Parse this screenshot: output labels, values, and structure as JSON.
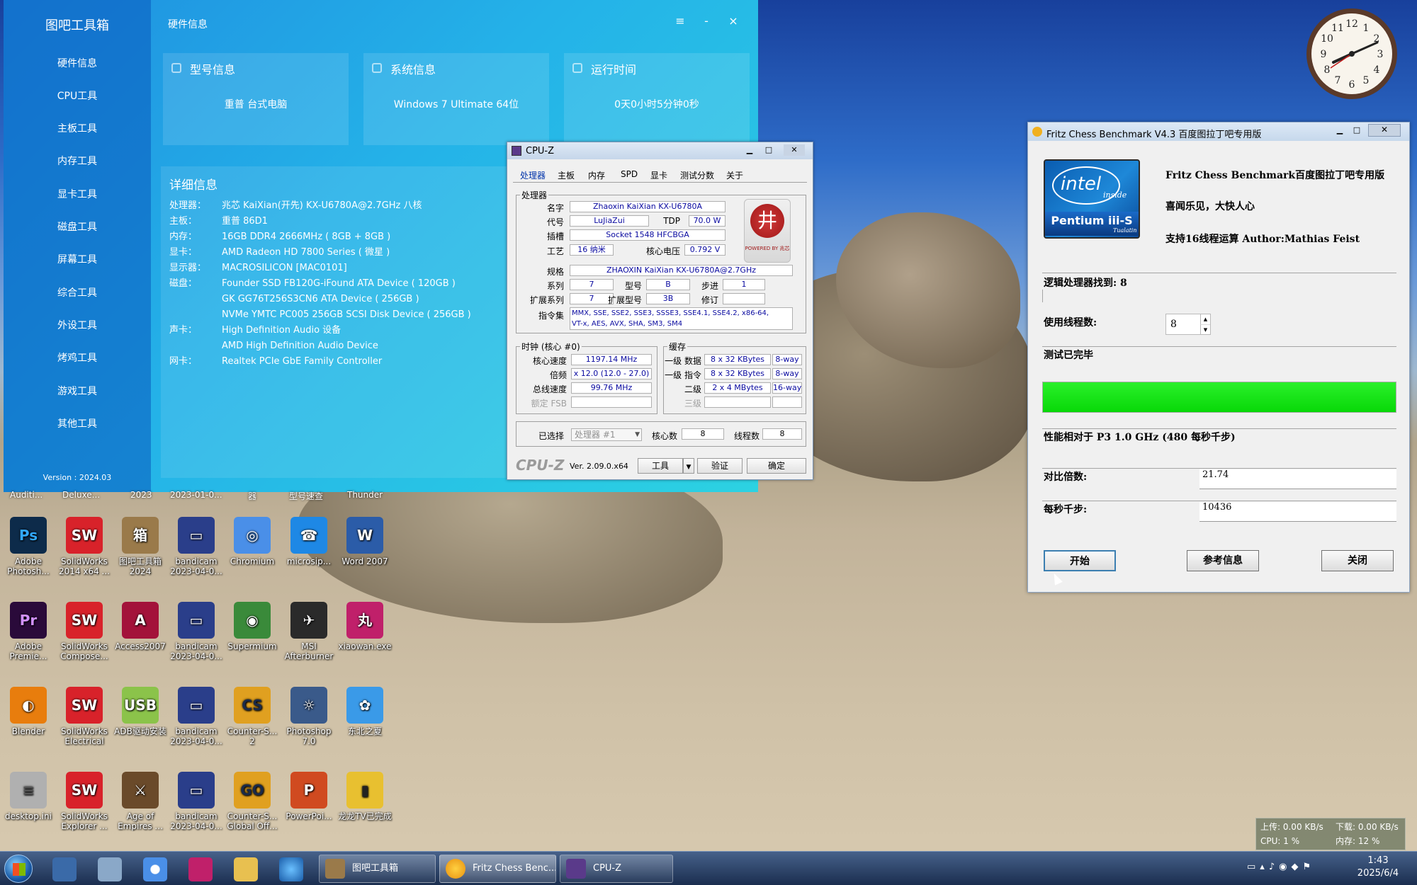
{
  "toolbox": {
    "app_title": "图吧工具箱",
    "window_title": "硬件信息",
    "version": "Version : 2024.03",
    "controls": {
      "menu": "≡",
      "minimize": "-",
      "close": "×"
    },
    "sidebar": [
      "硬件信息",
      "CPU工具",
      "主板工具",
      "内存工具",
      "显卡工具",
      "磁盘工具",
      "屏幕工具",
      "综合工具",
      "外设工具",
      "烤鸡工具",
      "游戏工具",
      "其他工具"
    ],
    "cards": [
      {
        "title": "型号信息",
        "value": "重普 台式电脑"
      },
      {
        "title": "系统信息",
        "value": "Windows 7 Ultimate 64位"
      },
      {
        "title": "运行时间",
        "value": "0天0小时5分钟0秒"
      }
    ],
    "details_title": "详细信息",
    "details": [
      {
        "label": "处理器：",
        "value": "兆芯 KaiXian(开先) KX-U6780A@2.7GHz 八核"
      },
      {
        "label": "主板：",
        "value": "重普 86D1"
      },
      {
        "label": "内存：",
        "value": "16GB DDR4 2666MHz ( 8GB + 8GB )"
      },
      {
        "label": "显卡：",
        "value": "AMD Radeon HD 7800 Series ( 微星 )"
      },
      {
        "label": "显示器：",
        "value": "MACROSILICON [MAC0101]"
      },
      {
        "label": "磁盘：",
        "value": "Founder SSD FB120G-iFound ATA Device ( 120GB )"
      },
      {
        "label": "",
        "value": "GK GG76T256S3CN6 ATA Device ( 256GB )"
      },
      {
        "label": "",
        "value": "NVMe YMTC PC005 256GB SCSI Disk Device ( 256GB )"
      },
      {
        "label": "声卡：",
        "value": "High Definition Audio 设备"
      },
      {
        "label": "",
        "value": "AMD High Definition Audio Device"
      },
      {
        "label": "网卡：",
        "value": "Realtek PCIe GbE Family Controller"
      }
    ]
  },
  "cpuz": {
    "title": "CPU-Z",
    "tabs": [
      "处理器",
      "主板",
      "内存",
      "SPD",
      "显卡",
      "测试分数",
      "关于"
    ],
    "group_processor": "处理器",
    "labels": {
      "name": "名字",
      "codename": "代号",
      "tdp": "TDP",
      "socket": "插槽",
      "process": "工艺",
      "vcore": "核心电压",
      "spec": "规格",
      "family": "系列",
      "model": "型号",
      "stepping": "步进",
      "ext_family": "扩展系列",
      "ext_model": "扩展型号",
      "revision": "修订",
      "instructions": "指令集"
    },
    "values": {
      "name": "Zhaoxin KaiXian KX-U6780A",
      "codename": "LuJiaZui",
      "tdp": "70.0 W",
      "socket": "Socket 1548 HFCBGA",
      "process": "16 纳米",
      "vcore": "0.792 V",
      "spec": "ZHAOXIN KaiXian KX-U6780A@2.7GHz",
      "family": "7",
      "model": "B",
      "stepping": "1",
      "ext_family": "7",
      "ext_model": "3B",
      "revision": "",
      "instructions_line1": "MMX, SSE, SSE2, SSE3, SSSE3, SSE4.1, SSE4.2, x86-64,",
      "instructions_line2": "VT-x, AES, AVX, SHA, SM3, SM4"
    },
    "logo_text": "POWERED BY 兆芯",
    "clock": {
      "group": "时钟 (核心 #0)",
      "core_speed_label": "核心速度",
      "core_speed": "1197.14 MHz",
      "multiplier_label": "倍频",
      "multiplier": "x 12.0 (12.0 - 27.0)",
      "bus_label": "总线速度",
      "bus": "99.76 MHz",
      "fsb_label": "额定 FSB",
      "fsb": ""
    },
    "cache": {
      "group": "缓存",
      "rows": [
        {
          "label": "一级 数据",
          "size": "8 x 32 KBytes",
          "way": "8-way"
        },
        {
          "label": "一级 指令",
          "size": "8 x 32 KBytes",
          "way": "8-way"
        },
        {
          "label": "二级",
          "size": "2 x 4 MBytes",
          "way": "16-way"
        },
        {
          "label": "三级",
          "size": "",
          "way": ""
        }
      ]
    },
    "selection": {
      "label": "已选择",
      "value": "处理器 #1",
      "cores_label": "核心数",
      "cores": "8",
      "threads_label": "线程数",
      "threads": "8"
    },
    "footer": {
      "brand": "CPU-Z",
      "version": "Ver. 2.09.0.x64",
      "tools": "工具",
      "validate": "验证",
      "ok": "确定"
    }
  },
  "fritz": {
    "title": "Fritz Chess Benchmark V4.3  百度图拉丁吧专用版",
    "intel_badge": {
      "brand": "intel",
      "inside": "inside",
      "product": "Pentium iii-S",
      "sub": "Tualatin"
    },
    "header_line1": "Fritz Chess Benchmark百度图拉丁吧专用版",
    "header_line2": "喜闻乐见，大快人心",
    "header_line3": "支持16线程运算  Author:Mathias Feist",
    "logical_processors": "逻辑处理器找到: 8",
    "threads_label": "使用线程数:",
    "threads_value": "8",
    "status": "测试已完毕",
    "progress": 1.0,
    "perf_label": "性能相对于 P3 1.0 GHz (480 每秒千步)",
    "ratio_label": "对比倍数:",
    "ratio_value": "21.74",
    "knps_label": "每秒千步:",
    "knps_value": "10436",
    "buttons": {
      "start": "开始",
      "reference": "参考信息",
      "close": "关闭"
    }
  },
  "desktop": {
    "partial_labels": [
      "Auditi...",
      "Deluxe...",
      "2023",
      "2023-01-0...",
      "器",
      "型号速查",
      "Thunder"
    ],
    "icons": [
      {
        "label": "Adobe Photosh...",
        "glyph": "Ps",
        "color": "#0d2b4a",
        "fg": "#31a8ff"
      },
      {
        "label": "SolidWorks 2014 x64 ...",
        "glyph": "SW",
        "color": "#d8222a",
        "fg": "#ffffff"
      },
      {
        "label": "图吧工具箱 2024",
        "glyph": "箱",
        "color": "#9a7a4a",
        "fg": "#ffffff"
      },
      {
        "label": "bandicam 2023-04-0...",
        "glyph": "▭",
        "color": "#2a3e8a",
        "fg": "#ffffff"
      },
      {
        "label": "Chromium",
        "glyph": "◎",
        "color": "#4a8fe8",
        "fg": "#ffffff"
      },
      {
        "label": "microsip...",
        "glyph": "☎",
        "color": "#1e88e5",
        "fg": "#ffffff"
      },
      {
        "label": "Word 2007",
        "glyph": "W",
        "color": "#2b5ca8",
        "fg": "#ffffff"
      },
      {
        "label": "Adobe Premie...",
        "glyph": "Pr",
        "color": "#2a0a3a",
        "fg": "#d291ff"
      },
      {
        "label": "SolidWorks Compose...",
        "glyph": "SW",
        "color": "#d8222a",
        "fg": "#ffffff"
      },
      {
        "label": "Access2007",
        "glyph": "A",
        "color": "#a3123a",
        "fg": "#ffffff"
      },
      {
        "label": "bandicam 2023-04-0...",
        "glyph": "▭",
        "color": "#2a3e8a",
        "fg": "#ffffff"
      },
      {
        "label": "Supermium",
        "glyph": "◉",
        "color": "#3a8a3a",
        "fg": "#ffffff"
      },
      {
        "label": "MSI Afterburner",
        "glyph": "✈",
        "color": "#2a2a2a",
        "fg": "#ffffff"
      },
      {
        "label": "xiaowan.exe",
        "glyph": "丸",
        "color": "#c0206a",
        "fg": "#ffffff"
      },
      {
        "label": "Blender",
        "glyph": "◐",
        "color": "#e87d0d",
        "fg": "#ffffff"
      },
      {
        "label": "SolidWorks Electrical",
        "glyph": "SW",
        "color": "#d8222a",
        "fg": "#ffffff"
      },
      {
        "label": "ADB驱动安装",
        "glyph": "USB",
        "color": "#8bc34a",
        "fg": "#ffffff"
      },
      {
        "label": "bandicam 2023-04-0...",
        "glyph": "▭",
        "color": "#2a3e8a",
        "fg": "#ffffff"
      },
      {
        "label": "Counter-S... 2",
        "glyph": "CS",
        "color": "#e0a020",
        "fg": "#1a2a4a"
      },
      {
        "label": "Photoshop 7.0",
        "glyph": "☼",
        "color": "#3a5a8a",
        "fg": "#ffffff"
      },
      {
        "label": "东北之夏",
        "glyph": "✿",
        "color": "#3a9ae8",
        "fg": "#ffffff"
      },
      {
        "label": "desktop.ini",
        "glyph": "≡",
        "color": "#b0b0b0",
        "fg": "#555555"
      },
      {
        "label": "SolidWorks Explorer ...",
        "glyph": "SW",
        "color": "#d8222a",
        "fg": "#ffffff"
      },
      {
        "label": "Age of Empires ...",
        "glyph": "⚔",
        "color": "#6a4a2a",
        "fg": "#ffffff"
      },
      {
        "label": "bandicam 2023-04-0...",
        "glyph": "▭",
        "color": "#2a3e8a",
        "fg": "#ffffff"
      },
      {
        "label": "Counter-S... Global Off...",
        "glyph": "GO",
        "color": "#e0a020",
        "fg": "#1a2a4a"
      },
      {
        "label": "PowerPoi...",
        "glyph": "P",
        "color": "#d04a20",
        "fg": "#ffffff"
      },
      {
        "label": "龙龙TV已完成",
        "glyph": "▮",
        "color": "#e8c030",
        "fg": "#222222"
      }
    ]
  },
  "taskbar": {
    "tasks": [
      {
        "label": "图吧工具箱"
      },
      {
        "label": "Fritz Chess Benc..."
      },
      {
        "label": "CPU-Z"
      }
    ],
    "netmon": {
      "upload": "上传: 0.00 KB/s",
      "download": "下载: 0.00 KB/s",
      "cpu": "CPU: 1 %",
      "mem": "内存: 12 %"
    },
    "time": "1:43",
    "date": "2025/6/4"
  }
}
